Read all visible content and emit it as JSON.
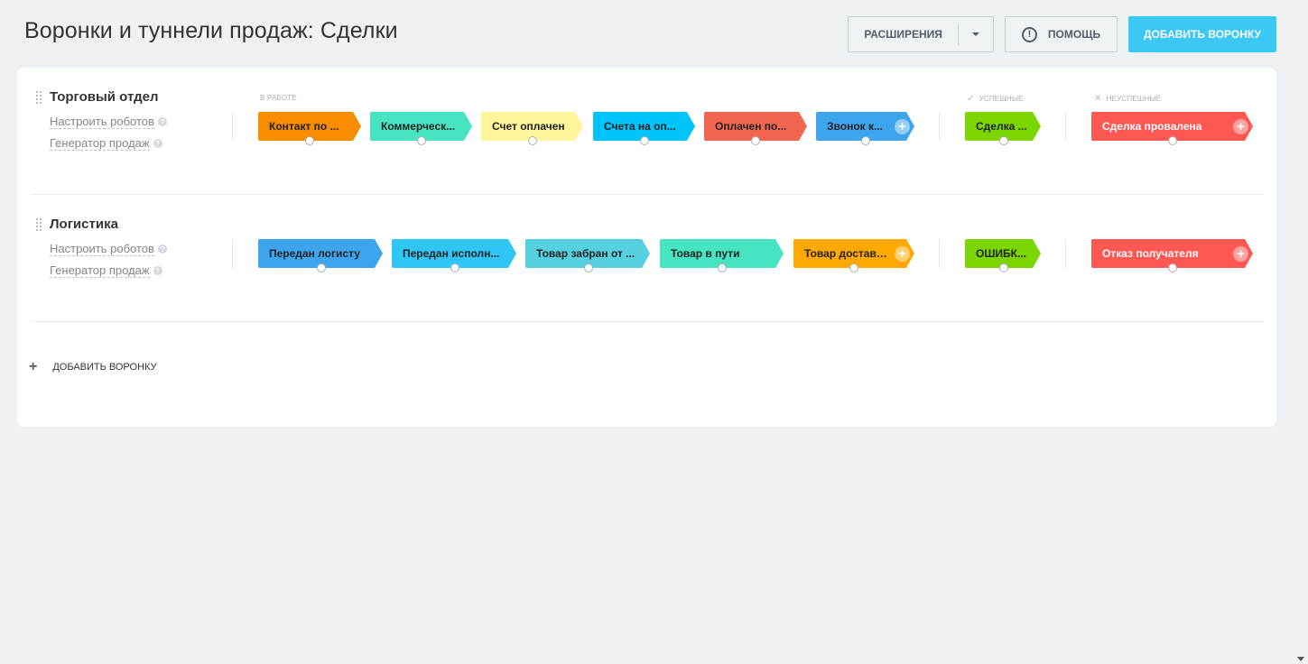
{
  "header": {
    "title": "Воронки и туннели продаж: Сделки",
    "extensions_label": "РАСШИРЕНИЯ",
    "help_label": "ПОМОЩЬ",
    "add_funnel_label": "ДОБАВИТЬ ВОРОНКУ"
  },
  "groups": {
    "in_work": "В РАБОТЕ",
    "success": "УСПЕШНЫЕ",
    "fail": "НЕУСПЕШНЫЕ"
  },
  "funnels": [
    {
      "name": "Торговый отдел",
      "robots_link": "Настроить роботов",
      "generator_link": "Генератор продаж",
      "stages": [
        {
          "label": "Контакт по ...",
          "color": "#fa8c00",
          "text_color": "#222222"
        },
        {
          "label": "Коммерческ...",
          "color": "#47e4c2",
          "text_color": "#222222"
        },
        {
          "label": "Счет оплачен",
          "color": "#fff69c",
          "text_color": "#222222"
        },
        {
          "label": "Счета на оп...",
          "color": "#00c4fb",
          "text_color": "#222222"
        },
        {
          "label": "Оплачен по...",
          "color": "#f26651",
          "text_color": "#222222"
        },
        {
          "label": "Звонок к...",
          "color": "#3da5ee",
          "text_color": "#222222"
        }
      ],
      "success_stage": {
        "label": "Сделка ...",
        "color": "#7bd500",
        "text_color": "#222222"
      },
      "fail_stage": {
        "label": "Сделка провалена",
        "color": "#ff5752",
        "text_color": "#ffffff"
      }
    },
    {
      "name": "Логистика",
      "robots_link": "Настроить роботов",
      "generator_link": "Генератор продаж",
      "stages": [
        {
          "label": "Передан логисту",
          "color": "#3da5ee",
          "text_color": "#222222"
        },
        {
          "label": "Передан исполн...",
          "color": "#2fc6f6",
          "text_color": "#222222"
        },
        {
          "label": "Товар забран от ...",
          "color": "#55d0e0",
          "text_color": "#222222"
        },
        {
          "label": "Товар в пути",
          "color": "#47e4c2",
          "text_color": "#222222"
        },
        {
          "label": "Товар доставл...",
          "color": "#ffa900",
          "text_color": "#222222"
        }
      ],
      "success_stage": {
        "label": "ОШИБК...",
        "color": "#7bd500",
        "text_color": "#222222"
      },
      "fail_stage": {
        "label": "Отказ получателя",
        "color": "#ff5752",
        "text_color": "#ffffff"
      }
    }
  ],
  "footer": {
    "add_funnel_label": "ДОБАВИТЬ ВОРОНКУ"
  }
}
